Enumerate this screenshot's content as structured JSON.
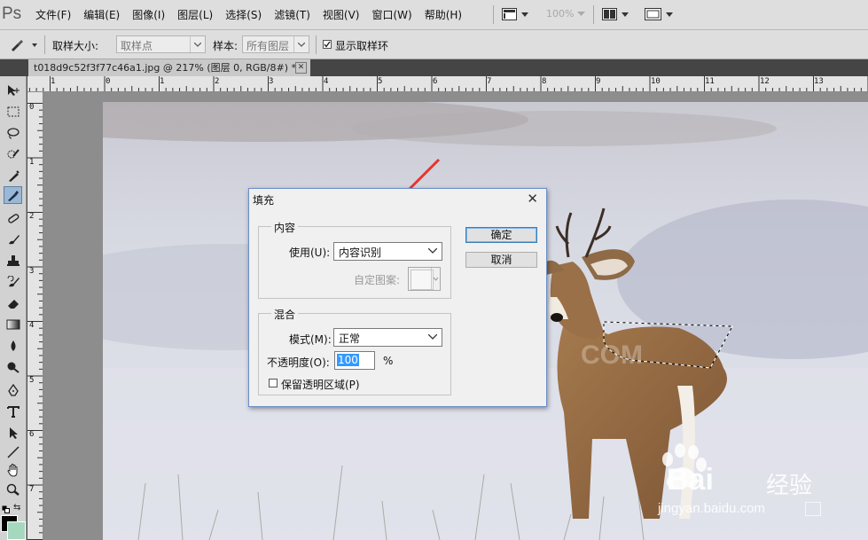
{
  "app": {
    "logo": "Ps",
    "menus": [
      "文件(F)",
      "编辑(E)",
      "图像(I)",
      "图层(L)",
      "选择(S)",
      "滤镜(T)",
      "视图(V)",
      "窗口(W)",
      "帮助(H)"
    ],
    "zoom": "100%"
  },
  "options": {
    "sample_size_label": "取样大小:",
    "sample_size_value": "取样点",
    "sample_label": "样本:",
    "sample_value": "所有图层",
    "show_ring_label": "显示取样环",
    "show_ring_checked": true
  },
  "document": {
    "tab_title": "t018d9c52f3f77c46a1.jpg @ 217% (图层 0, RGB/8#) *",
    "close_glyph": "✕"
  },
  "rulers": {
    "horizontal": [
      "1",
      "0",
      "1",
      "2",
      "3",
      "4",
      "5",
      "6",
      "7",
      "8",
      "9",
      "10",
      "11",
      "12",
      "13"
    ],
    "vertical": [
      "0",
      "1",
      "2",
      "3",
      "4",
      "5",
      "6",
      "7"
    ]
  },
  "dialog": {
    "title": "填充",
    "close_glyph": "✕",
    "content_group": "内容",
    "use_label": "使用(U):",
    "use_value": "内容识别",
    "pattern_label": "自定图案:",
    "blend_group": "混合",
    "mode_label": "模式(M):",
    "mode_value": "正常",
    "opacity_label": "不透明度(O):",
    "opacity_value": "100",
    "opacity_unit": "%",
    "preserve_label": "保留透明区域(P)",
    "preserve_checked": false,
    "ok_label": "确定",
    "cancel_label": "取消"
  },
  "watermark": {
    "brand": "Bai",
    "brand_suffix": "经验",
    "url": "jingyan.baidu.com",
    "faint": "COM"
  },
  "icons": {
    "tools": [
      "move-icon",
      "marquee-icon",
      "lasso-icon",
      "quick-select-icon",
      "crop-icon",
      "eyedropper-icon",
      "healing-icon",
      "brush-icon",
      "stamp-icon",
      "history-brush-icon",
      "eraser-icon",
      "gradient-icon",
      "blur-icon",
      "dodge-icon",
      "pen-icon",
      "type-icon",
      "path-select-icon",
      "line-icon",
      "hand-icon",
      "zoom-icon"
    ]
  },
  "colors": {
    "accent_arrow": "#e8322d",
    "active_tool": "#9ab8d6",
    "dialog_border": "#6a8ec8",
    "selection_highlight": "#3399ff",
    "foreground_swatch": "#000000",
    "background_swatch": "#a6d8c0"
  }
}
